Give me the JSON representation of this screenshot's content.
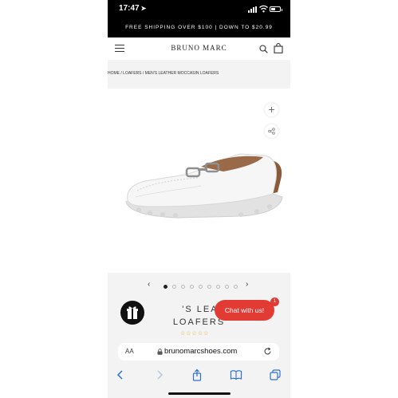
{
  "status_bar": {
    "time": "17:47",
    "location_arrow": "➤",
    "battery_level": 0.5
  },
  "promo_banner": {
    "text": "FREE SHIPPING OVER $100 | DOWN TO $20.99"
  },
  "header": {
    "logo": "BRUNO MARC",
    "menu_icon": "hamburger-menu-icon",
    "search_icon": "search-icon",
    "cart_icon": "shopping-bag-icon"
  },
  "breadcrumb": {
    "text": "HOME / LOAFERS / MEN'S LEATHER MOCCASIN LOAFERS"
  },
  "product": {
    "image": "white-leather-driving-moccasin-loafer",
    "zoom_icon": "plus-icon",
    "share_icon": "share-icon"
  },
  "carousel": {
    "prev": "‹",
    "next": "›",
    "dot_count": 9,
    "active_index": 0
  },
  "product_title": {
    "line1": "'S LEATHER",
    "line2": "LOAFERS"
  },
  "rating": {
    "stars": "☆☆☆☆☆",
    "value": 0
  },
  "gift_button": {
    "icon": "gift-icon"
  },
  "chat": {
    "label": "Chat with us!",
    "badge": "1"
  },
  "browser": {
    "aa": "AA",
    "url": "brunomarcshoes.com",
    "lock_icon": "lock-icon",
    "reload_icon": "reload-icon"
  },
  "toolbar": {
    "back_icon": "back-icon",
    "forward_icon": "forward-icon",
    "share_icon": "share-icon",
    "bookmarks_icon": "book-icon",
    "tabs_icon": "tabs-icon"
  }
}
